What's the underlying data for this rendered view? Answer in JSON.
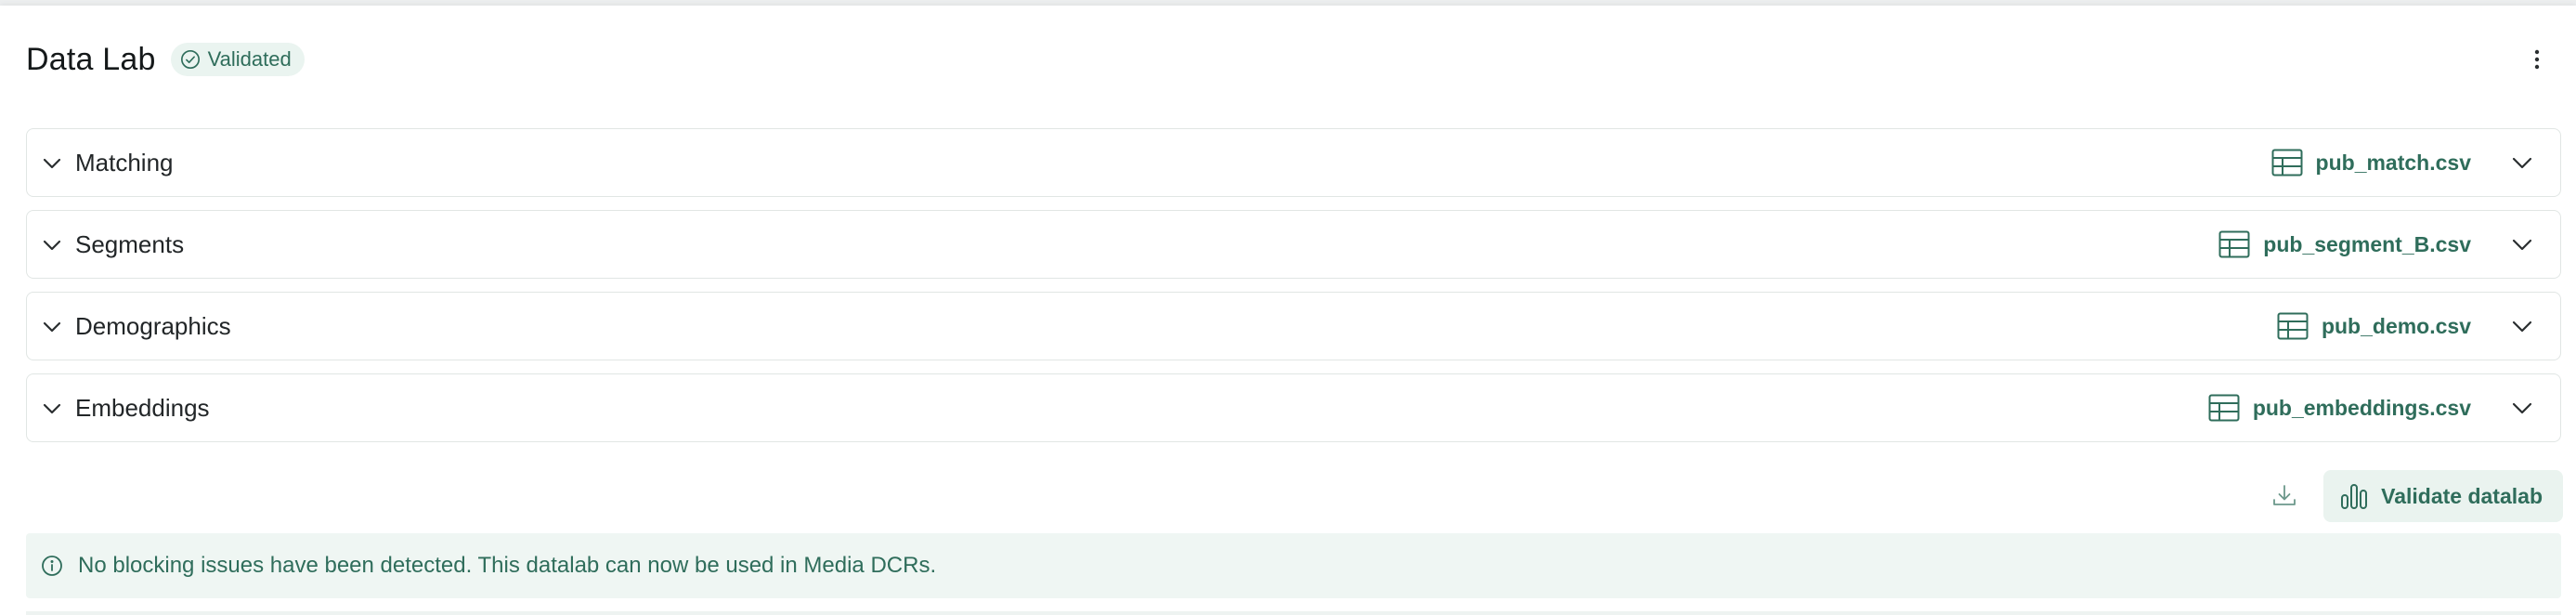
{
  "header": {
    "title": "Data Lab",
    "badge": "Validated",
    "menu_icon": "more-vertical-icon"
  },
  "sections": [
    {
      "label": "Matching",
      "file": "pub_match.csv"
    },
    {
      "label": "Segments",
      "file": "pub_segment_B.csv"
    },
    {
      "label": "Demographics",
      "file": "pub_demo.csv"
    },
    {
      "label": "Embeddings",
      "file": "pub_embeddings.csv"
    }
  ],
  "actions": {
    "download_icon": "download-icon",
    "validate_label": "Validate datalab"
  },
  "alert": {
    "message": "No blocking issues have been detected. This datalab can now be used in Media DCRs."
  },
  "colors": {
    "accent": "#2f6d5b",
    "accent_bg": "#eaf4f0",
    "border": "#e1e6e4"
  }
}
